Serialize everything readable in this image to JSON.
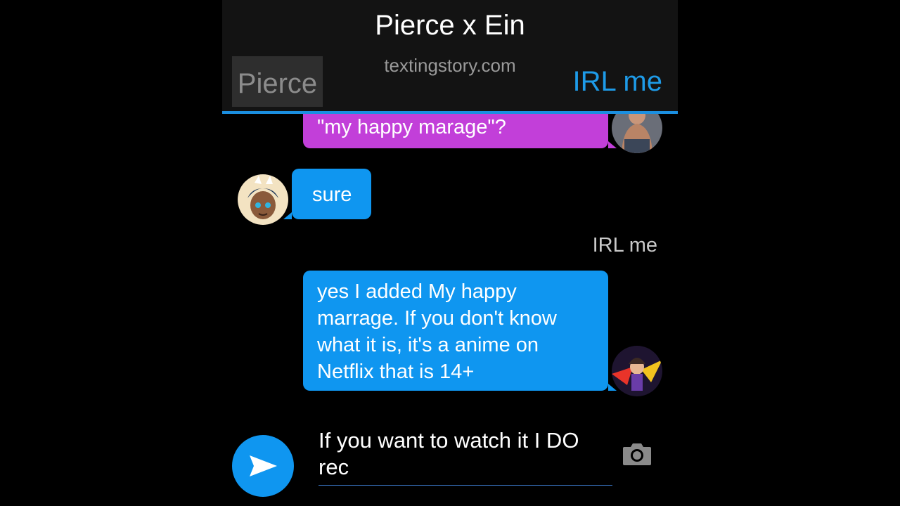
{
  "header": {
    "title": "Pierce x Ein",
    "site": "textingstory.com",
    "left_contact": "Pierce",
    "right_contact": "IRL me"
  },
  "messages": [
    {
      "from": "IRL me",
      "text": "\"my happy marage\"?",
      "color": "#c23fd9"
    },
    {
      "from": "Pierce",
      "text": "sure",
      "color": "#0f96f0"
    },
    {
      "from": "IRL me",
      "sender_label": "IRL me",
      "lines": [
        "yes I added My happy",
        "marrage. If you don't know",
        "what it is, it's a anime on",
        "Netflix that is 14+"
      ],
      "color": "#0f96f0"
    }
  ],
  "composer": {
    "lines": [
      "If you want to watch it I DO",
      "rec"
    ],
    "send_icon": "send-icon",
    "camera_icon": "camera-icon"
  },
  "colors": {
    "accent": "#1e9be8",
    "purple_bubble": "#c23fd9",
    "blue_bubble": "#0f96f0",
    "header_bg": "#131313"
  }
}
